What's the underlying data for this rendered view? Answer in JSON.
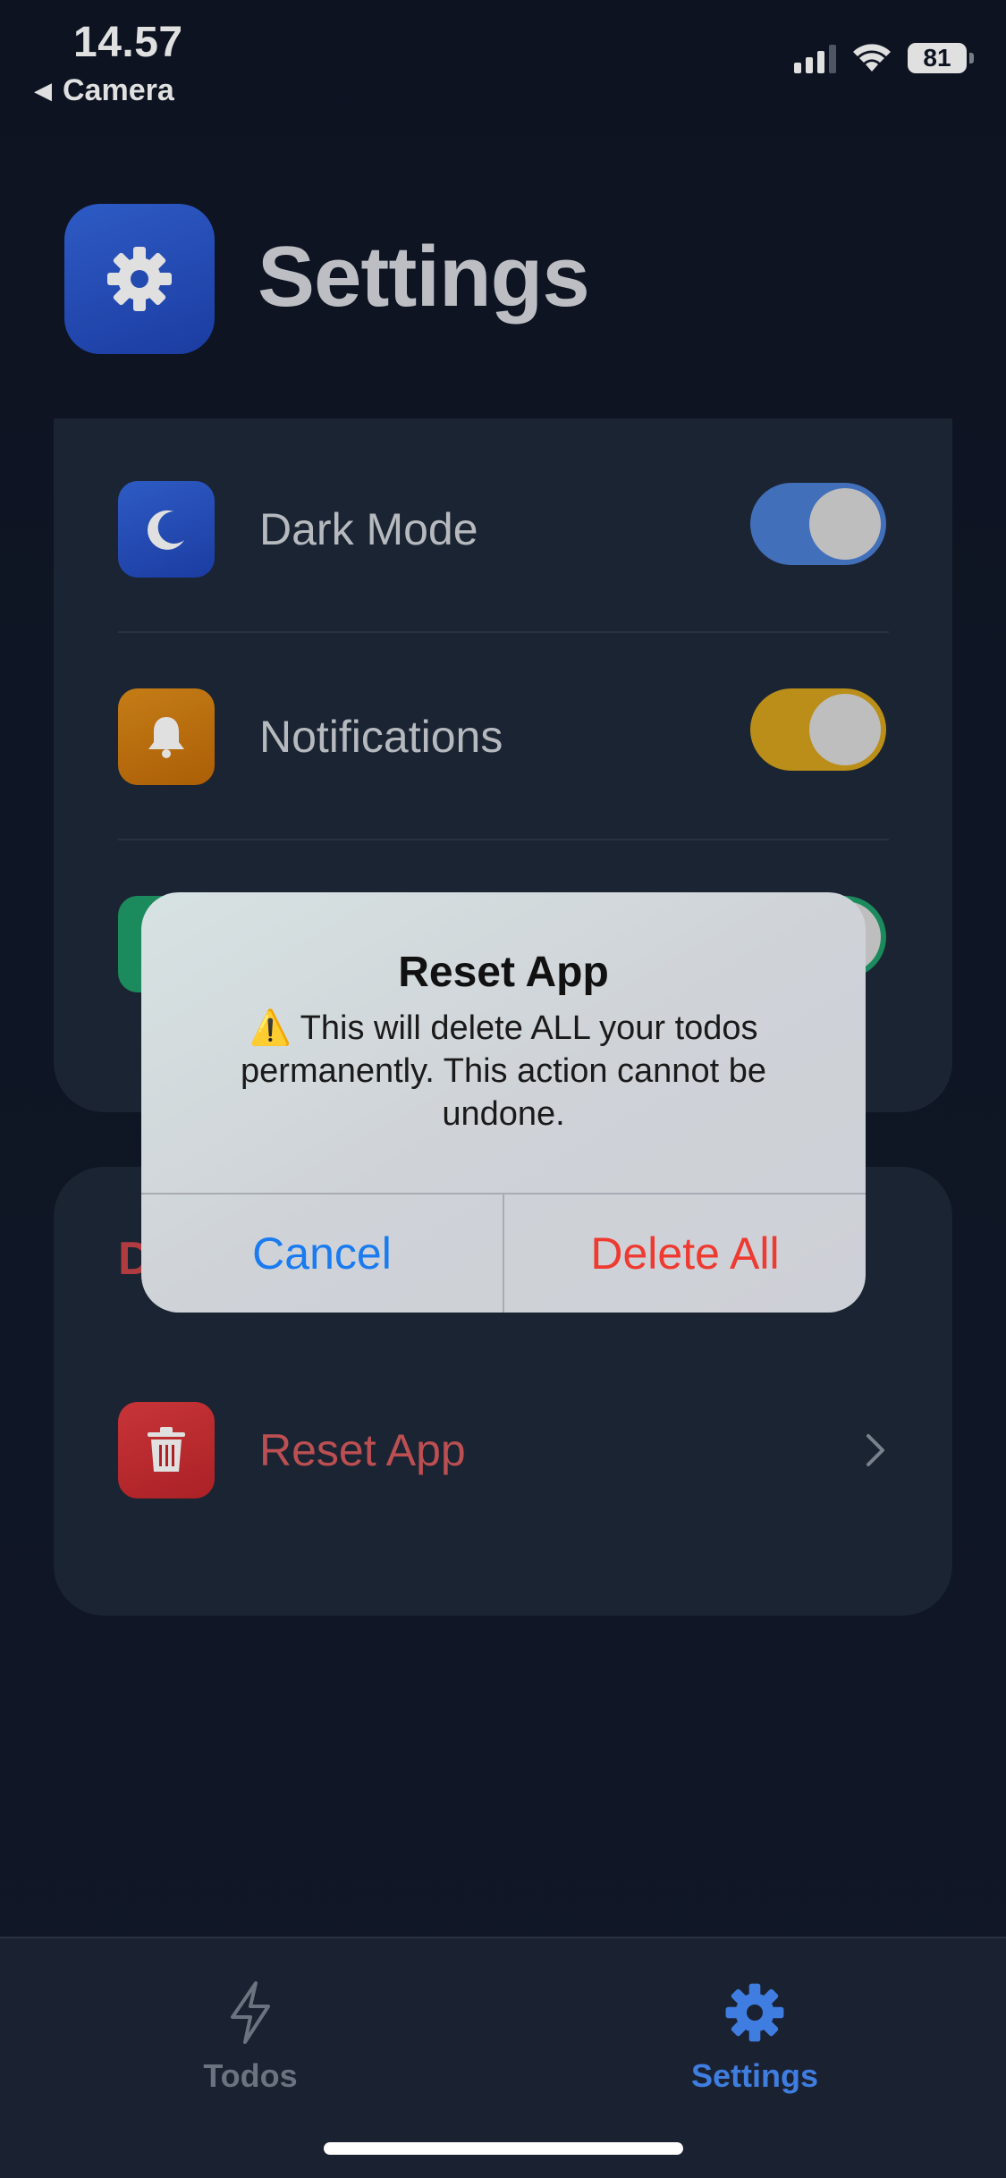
{
  "status_bar": {
    "time": "14.57",
    "back_label": "Camera",
    "battery": "81"
  },
  "header": {
    "title": "Settings",
    "icon": "gear-icon"
  },
  "settings": {
    "dark_mode": {
      "label": "Dark Mode",
      "icon": "moon-icon",
      "on": true,
      "color": "#4a7fd4"
    },
    "notifications": {
      "label": "Notifications",
      "icon": "bell-icon",
      "on": true,
      "color": "#d4a21c"
    },
    "third_toggle_color": "#1f9e6a"
  },
  "danger": {
    "section_label": "D",
    "reset_label": "Reset App",
    "reset_icon": "trash-icon",
    "color": "#d5343a"
  },
  "alert": {
    "title": "Reset App",
    "message": "⚠️ This will delete ALL your todos permanently. This action cannot be undone.",
    "cancel_label": "Cancel",
    "delete_label": "Delete All"
  },
  "tabbar": {
    "todos_label": "Todos",
    "settings_label": "Settings",
    "active": "Settings"
  }
}
